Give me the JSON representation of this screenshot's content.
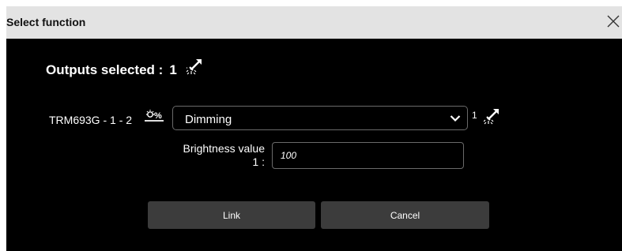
{
  "dialog": {
    "title": "Select function",
    "close_icon": "close-icon"
  },
  "summary": {
    "label": "Outputs selected :",
    "count": "1",
    "icon": "output-lamp-icon"
  },
  "output_row": {
    "name": "TRM693G - 1 - 2",
    "type_icon_text": "%",
    "type_icon": "dimmer-icon",
    "function_select": {
      "value": "Dimming",
      "icon": "chevron-down-icon"
    },
    "channel_count": "1",
    "channel_icon": "output-lamp-icon"
  },
  "brightness": {
    "label_line1": "Brightness value",
    "label_line2": "1 :",
    "value": "100"
  },
  "buttons": {
    "link": "Link",
    "cancel": "Cancel"
  },
  "colors": {
    "background": "#000000",
    "titlebar": "#e3e3e3",
    "button": "#3c3c3c",
    "border": "#6a6a6a",
    "text": "#ffffff"
  }
}
